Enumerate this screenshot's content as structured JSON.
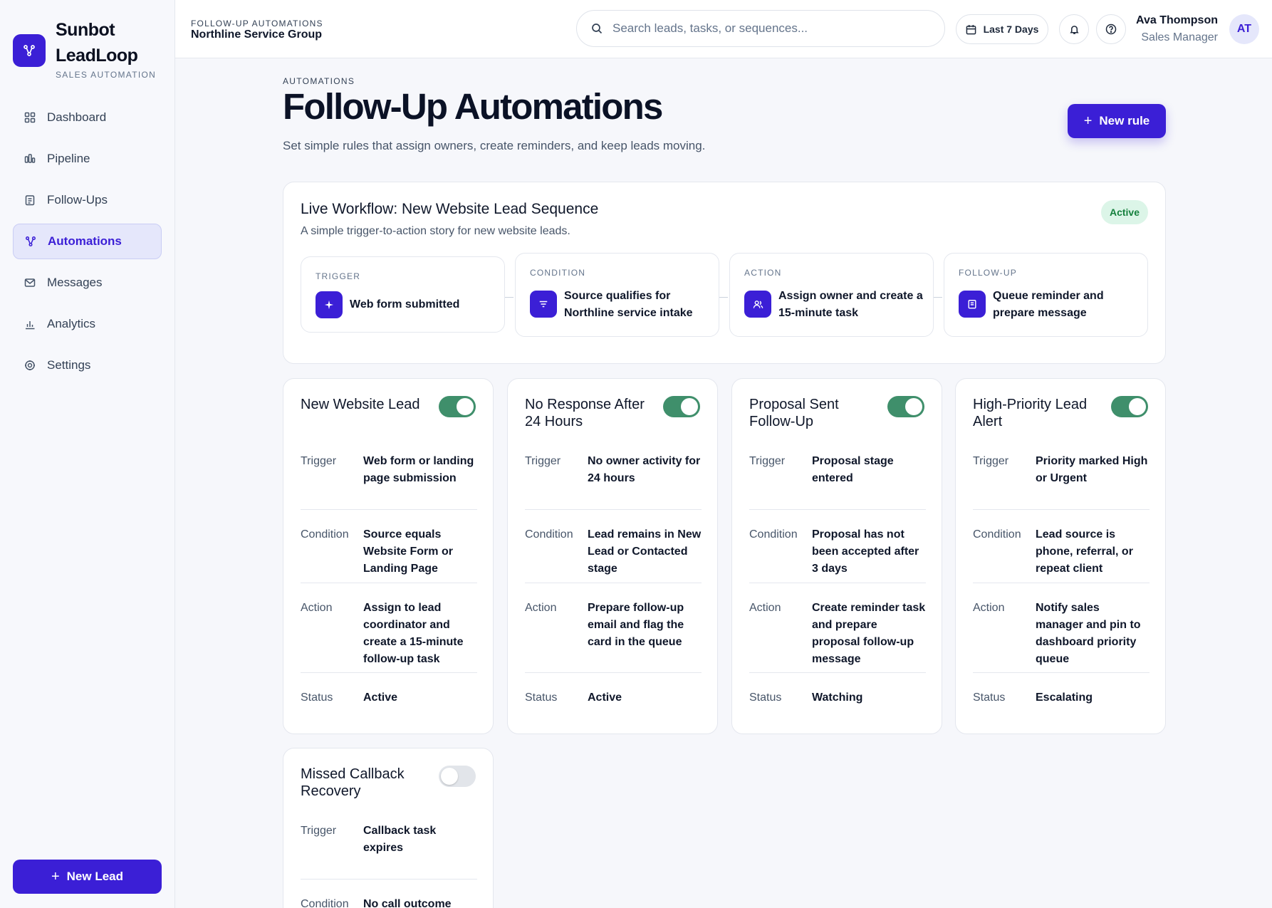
{
  "brand": {
    "name_line1": "Sunbot",
    "name_line2": "LeadLoop",
    "tagline": "SALES AUTOMATION"
  },
  "nav": [
    {
      "label": "Dashboard",
      "icon": "dashboard-icon"
    },
    {
      "label": "Pipeline",
      "icon": "pipeline-icon"
    },
    {
      "label": "Follow-Ups",
      "icon": "follow-ups-icon"
    },
    {
      "label": "Automations",
      "icon": "automations-icon",
      "active": true
    },
    {
      "label": "Messages",
      "icon": "messages-icon"
    },
    {
      "label": "Analytics",
      "icon": "analytics-icon"
    },
    {
      "label": "Settings",
      "icon": "settings-icon"
    }
  ],
  "new_lead_label": "New Lead",
  "topbar": {
    "kicker": "FOLLOW-UP AUTOMATIONS",
    "org": "Northline Service Group",
    "search_placeholder": "Search leads, tasks, or sequences...",
    "date_range": "Last 7 Days",
    "user_name": "Ava Thompson",
    "user_role": "Sales Manager",
    "user_initials": "AT"
  },
  "page": {
    "kicker": "AUTOMATIONS",
    "title": "Follow-Up Automations",
    "subtitle": "Set simple rules that assign owners, create reminders, and keep leads moving.",
    "new_rule_label": "New rule"
  },
  "workflow": {
    "title": "Live Workflow: New Website Lead Sequence",
    "subtitle": "A simple trigger-to-action story for new website leads.",
    "badge": "Active",
    "steps": [
      {
        "kicker": "TRIGGER",
        "text": "Web form submitted",
        "icon": "sparkle-icon"
      },
      {
        "kicker": "CONDITION",
        "text": "Source qualifies for Northline service intake",
        "icon": "filter-icon"
      },
      {
        "kicker": "ACTION",
        "text": "Assign owner and create a 15-minute task",
        "icon": "users-icon"
      },
      {
        "kicker": "FOLLOW-UP",
        "text": "Queue reminder and prepare message",
        "icon": "clipboard-icon"
      }
    ]
  },
  "labels": {
    "trigger": "Trigger",
    "condition": "Condition",
    "action": "Action",
    "status": "Status"
  },
  "rules": [
    {
      "title": "New Website Lead",
      "enabled": true,
      "trigger": "Web form or landing page submission",
      "condition": "Source equals Website Form or Landing Page",
      "action": "Assign to lead coordinator and create a 15-minute follow-up task",
      "status": "Active"
    },
    {
      "title": "No Response After 24 Hours",
      "enabled": true,
      "trigger": "No owner activity for 24 hours",
      "condition": "Lead remains in New Lead or Contacted stage",
      "action": "Prepare follow-up email and flag the card in the queue",
      "status": "Active"
    },
    {
      "title": "Proposal Sent Follow-Up",
      "enabled": true,
      "trigger": "Proposal stage entered",
      "condition": "Proposal has not been accepted after 3 days",
      "action": "Create reminder task and prepare proposal follow-up message",
      "status": "Watching"
    },
    {
      "title": "High-Priority Lead Alert",
      "enabled": true,
      "trigger": "Priority marked High or Urgent",
      "condition": "Lead source is phone, referral, or repeat client",
      "action": "Notify sales manager and pin to dashboard priority queue",
      "status": "Escalating"
    },
    {
      "title": "Missed Callback Recovery",
      "enabled": false,
      "trigger": "Callback task expires",
      "condition": "No call outcome"
    }
  ],
  "colors": {
    "accent": "#3b1fd6",
    "toggle_on": "#3f8f6b",
    "active_badge_bg": "#dcf5e8",
    "active_badge_text": "#15803d"
  }
}
